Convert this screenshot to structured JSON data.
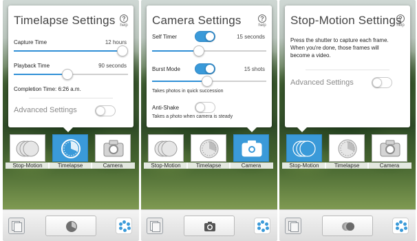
{
  "colors": {
    "accent": "#3a9ad9",
    "panel": "#ffffff",
    "text": "#222222",
    "muted": "#8a8a8a"
  },
  "screens": [
    {
      "title": "Timelapse Settings",
      "help": "help",
      "rows": [
        {
          "label": "Capture Time",
          "value": "12 hours",
          "slider_fraction": 1.0
        },
        {
          "label": "Playback Time",
          "value": "90 seconds",
          "slider_fraction": 0.47
        }
      ],
      "completion": "Completion Time: 6:26 a.m.",
      "advanced": "Advanced Settings",
      "advanced_on": false,
      "selected_mode": "timelapse"
    },
    {
      "title": "Camera Settings",
      "help": "help",
      "self_timer": {
        "label": "Self Timer",
        "value": "15 seconds",
        "on": true,
        "slider_fraction": 0.41
      },
      "burst_mode": {
        "label": "Burst Mode",
        "value": "15 shots",
        "on": true,
        "slider_fraction": 0.48,
        "hint": "Takes photos in quick succession"
      },
      "anti_shake": {
        "label": "Anti-Shake",
        "on": false,
        "hint": "Takes a photo when camera is steady"
      },
      "selected_mode": "camera"
    },
    {
      "title": "Stop-Motion Settings",
      "help": "help",
      "description": [
        "Press the shutter to capture each frame.",
        "When you're done, those frames will",
        "become a video."
      ],
      "advanced": "Advanced Settings",
      "advanced_on": false,
      "selected_mode": "stop-motion"
    }
  ],
  "modes": [
    {
      "id": "stop-motion",
      "label": "Stop-Motion",
      "icon": "stop-motion-icon"
    },
    {
      "id": "timelapse",
      "label": "Timelapse",
      "icon": "timelapse-icon"
    },
    {
      "id": "camera",
      "label": "Camera",
      "icon": "camera-icon"
    }
  ],
  "bottom_bar": {
    "gallery": "gallery-icon",
    "effects": "effects-icon"
  }
}
